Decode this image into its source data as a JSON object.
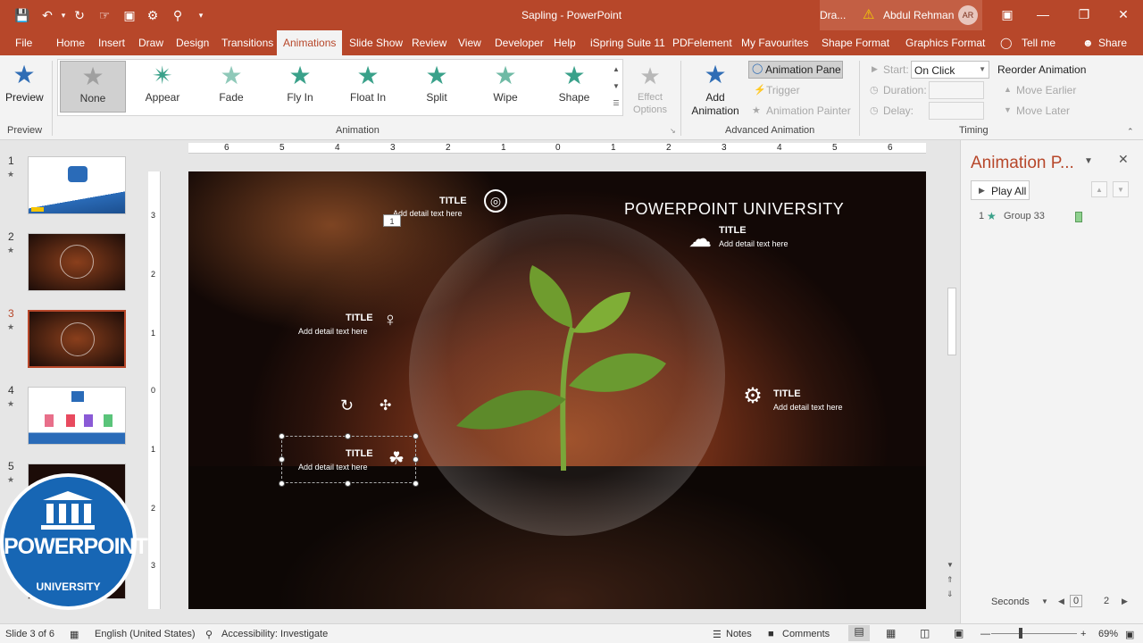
{
  "app": {
    "doc_title": "Sapling  -  PowerPoint",
    "user_short": "Dra...",
    "user_name": "Abdul Rehman",
    "user_initials": "AR",
    "accent": "#b7472a"
  },
  "tabs": [
    "File",
    "Home",
    "Insert",
    "Draw",
    "Design",
    "Transitions",
    "Animations",
    "Slide Show",
    "Review",
    "View",
    "Developer",
    "Help",
    "iSpring Suite 11",
    "PDFelement",
    "My Favourites",
    "Shape Format",
    "Graphics Format",
    "Tell me",
    "Share"
  ],
  "ribbon": {
    "preview_label": "Preview",
    "preview_group": "Preview",
    "animation_group": "Animation",
    "animations": [
      "None",
      "Appear",
      "Fade",
      "Fly In",
      "Float In",
      "Split",
      "Wipe",
      "Shape"
    ],
    "effect_options": "Effect Options",
    "add_animation": "Add Animation",
    "animation_pane": "Animation Pane",
    "trigger": "Trigger",
    "animation_painter": "Animation Painter",
    "advanced_group": "Advanced Animation",
    "start_label": "Start:",
    "start_value": "On Click",
    "duration_label": "Duration:",
    "delay_label": "Delay:",
    "timing_group": "Timing",
    "reorder": "Reorder Animation",
    "move_earlier": "Move Earlier",
    "move_later": "Move Later"
  },
  "ruler": {
    "h_numbers": [
      "6",
      "5",
      "4",
      "3",
      "2",
      "1",
      "0",
      "1",
      "2",
      "3",
      "4",
      "5",
      "6"
    ],
    "v_numbers": [
      "3",
      "2",
      "1",
      "0",
      "1",
      "2",
      "3"
    ]
  },
  "slides": [
    "1",
    "2",
    "3",
    "4",
    "5"
  ],
  "slide": {
    "heading": "POWERPOINT UNIVERSITY",
    "items": [
      {
        "title": "TITLE",
        "detail": "Add detail text here"
      },
      {
        "title": "TITLE",
        "detail": "Add detail text here"
      },
      {
        "title": "TITLE",
        "detail": "Add detail text here"
      },
      {
        "title": "TITLE",
        "detail": "Add detail text here"
      },
      {
        "title": "TITLE",
        "detail": "Add detail text here"
      }
    ],
    "anim_tag": "1"
  },
  "anim_pane": {
    "title": "Animation P...",
    "play_all": "Play All",
    "entry_number": "1",
    "entry_name": "Group 33",
    "seconds": "Seconds",
    "timeline_start": "0",
    "timeline_end": "2"
  },
  "status": {
    "slide_info": "Slide 3 of 6",
    "language": "English (United States)",
    "accessibility": "Accessibility: Investigate",
    "notes": "Notes",
    "comments": "Comments",
    "zoom": "69%"
  },
  "logo": {
    "top_text": "POWERPOINT",
    "bottom_text": "UNIVERSITY"
  }
}
